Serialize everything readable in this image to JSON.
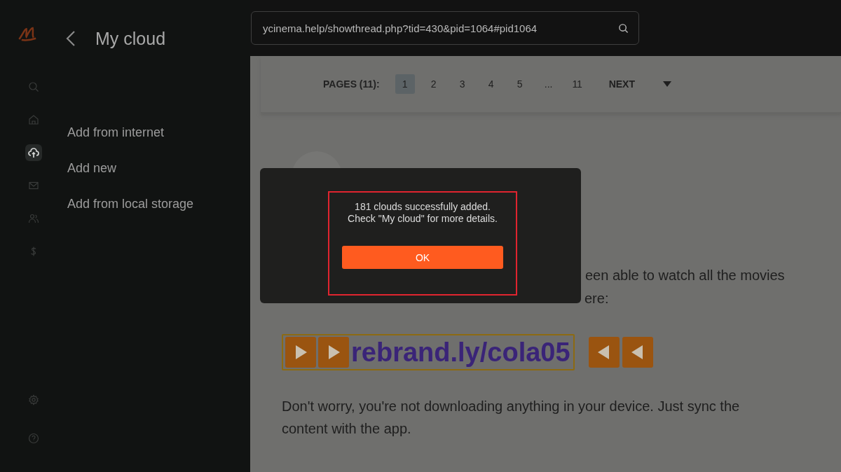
{
  "sidebar": {
    "items": [
      {
        "selected": false
      },
      {
        "selected": false
      },
      {
        "selected": true
      },
      {
        "selected": false
      },
      {
        "selected": false
      },
      {
        "selected": false
      }
    ],
    "bottom_items": [
      {
        "selected": false
      },
      {
        "selected": false
      }
    ]
  },
  "panel": {
    "title": "My cloud",
    "items": [
      "Add from internet",
      "Add new",
      "Add from local storage"
    ]
  },
  "browser": {
    "url": "ycinema.help/showthread.php?tid=430&pid=1064#pid1064"
  },
  "pagination": {
    "label": "PAGES (11):",
    "pages": [
      {
        "label": "1",
        "selected": true
      },
      {
        "label": "2",
        "selected": false
      },
      {
        "label": "3",
        "selected": false
      },
      {
        "label": "4",
        "selected": false
      },
      {
        "label": "5",
        "selected": false
      },
      {
        "label": "...",
        "selected": false
      },
      {
        "label": "11",
        "selected": false
      }
    ],
    "next": "NEXT"
  },
  "post": {
    "line_1": "een able to watch all the movies",
    "line_2": "ere:",
    "link": "rebrand.ly/cola05",
    "paragraph": "Don't worry, you're not downloading anything in your device. Just sync the content with the app."
  },
  "dialog": {
    "message_1": "181 clouds successfully added.",
    "message_2": "Check \"My cloud\" for more details.",
    "button": "OK",
    "highlighted": true
  }
}
